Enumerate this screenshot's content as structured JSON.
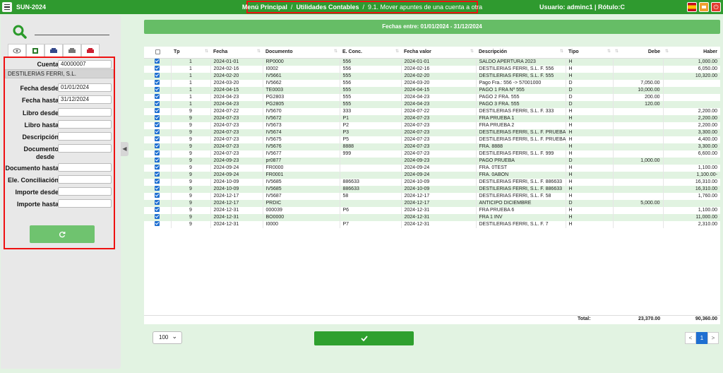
{
  "app": {
    "title": "SUN-2024"
  },
  "breadcrumb": {
    "item1": "Menú Principal",
    "item2": "Utilidades Contables",
    "current": "9.1. Mover apuntes de una cuenta a otra",
    "sep": "/"
  },
  "user": {
    "text": "Usuario: adminc1 | Rótulo:C"
  },
  "icons": {
    "menu": "hamburger-icon",
    "flag": "spain-flag-icon",
    "print": "print-icon",
    "power": "power-icon",
    "search": "search-icon",
    "refresh": "refresh-icon",
    "check": "check-icon"
  },
  "filters": {
    "cuenta_label": "Cuenta",
    "cuenta_value": "40000007",
    "company": "DESTILERIAS FERRI, S.L.",
    "fecha_desde_label": "Fecha desde",
    "fecha_desde_value": "01/01/2024",
    "fecha_hasta_label": "Fecha hasta",
    "fecha_hasta_value": "31/12/2024",
    "libro_desde_label": "Libro desde",
    "libro_hasta_label": "Libro hasta",
    "descripcion_label": "Descripción",
    "doc_desde_label1": "Documento",
    "doc_desde_label2": "desde",
    "doc_hasta_label": "Documento hasta",
    "ele_conc_label": "Ele. Conciliación",
    "importe_desde_label": "Importe desde",
    "importe_hasta_label": "Importe hasta"
  },
  "dates_bar": "Fechas entre: 01/01/2024 - 31/12/2024",
  "table": {
    "columns": [
      "Tp",
      "Fecha",
      "Documento",
      "E. Conc.",
      "Fecha valor",
      "Descripción",
      "Tipo",
      "Debe",
      "Haber"
    ],
    "rows": [
      [
        "1",
        "2024-01-01",
        "RP0000",
        "556",
        "2024-01-01",
        "SALDO APERTURA 2023",
        "H",
        "",
        "1,000.00"
      ],
      [
        "1",
        "2024-02-16",
        "I0002",
        "556",
        "2024-02-16",
        "DESTILERIAS FERRI, S.L. F. 556",
        "H",
        "",
        "6,050.00"
      ],
      [
        "1",
        "2024-02-20",
        "IV5661",
        "555",
        "2024-02-20",
        "DESTILERIAS FERRI, S.L. F. 555",
        "H",
        "",
        "10,320.00"
      ],
      [
        "1",
        "2024-03-20",
        "IV5662",
        "556",
        "2024-03-20",
        "Pago Fra.: 556 -> 57001000",
        "D",
        "7,050.00",
        ""
      ],
      [
        "1",
        "2024-04-15",
        "TE0003",
        "555",
        "2024-04-15",
        "PAGO 1 FRA Nº 555",
        "D",
        "10,000.00",
        ""
      ],
      [
        "1",
        "2024-04-23",
        "PG2803",
        "555",
        "2024-04-23",
        "PAGO 2 FRA. 555",
        "D",
        "200.00",
        ""
      ],
      [
        "1",
        "2024-04-23",
        "PG2805",
        "555",
        "2024-04-23",
        "PAGO 3 FRA. 555",
        "D",
        "120.00",
        ""
      ],
      [
        "9",
        "2024-07-22",
        "IV5670",
        "333",
        "2024-07-22",
        "DESTILERIAS FERRI, S.L. F. 333",
        "H",
        "",
        "2,200.00"
      ],
      [
        "9",
        "2024-07-23",
        "IV5672",
        "P1",
        "2024-07-23",
        "FRA PRUEBA 1",
        "H",
        "",
        "2,200.00"
      ],
      [
        "9",
        "2024-07-23",
        "IV5673",
        "P2",
        "2024-07-23",
        "FRA PRUEBA 2",
        "H",
        "",
        "2,200.00"
      ],
      [
        "9",
        "2024-07-23",
        "IV5674",
        "P3",
        "2024-07-23",
        "DESTILERIAS FERRI, S.L. F. PRUEBA 3",
        "H",
        "",
        "3,300.00"
      ],
      [
        "9",
        "2024-07-23",
        "IV5675",
        "P5",
        "2024-07-23",
        "DESTILERIAS FERRI, S.L. F. PRUEBA 5",
        "H",
        "",
        "4,400.00"
      ],
      [
        "9",
        "2024-07-23",
        "IV5676",
        "8888",
        "2024-07-23",
        "FRA. 8888",
        "H",
        "",
        "3,300.00"
      ],
      [
        "9",
        "2024-07-23",
        "IV5677",
        "999",
        "2024-07-23",
        "DESTILERIAS FERRI, S.L. F. 999",
        "H",
        "",
        "6,600.00"
      ],
      [
        "9",
        "2024-09-23",
        "pr0877",
        "",
        "2024-09-23",
        "PAGO PRUEBA",
        "D",
        "1,000.00",
        ""
      ],
      [
        "9",
        "2024-09-24",
        "FR0000",
        "",
        "2024-09-24",
        "FRA. 0TEST",
        "H",
        "",
        "1,100.00"
      ],
      [
        "9",
        "2024-09-24",
        "FR0001",
        "",
        "2024-09-24",
        "FRA. 0ABON",
        "H",
        "",
        "1,100.00-"
      ],
      [
        "9",
        "2024-10-09",
        "IV5685",
        "886633",
        "2024-10-09",
        "DESTILERIAS FERRI, S.L. F. 886633",
        "H",
        "",
        "16,310.00"
      ],
      [
        "9",
        "2024-10-09",
        "IV5685",
        "886633",
        "2024-10-09",
        "DESTILERIAS FERRI, S.L. F. 886633",
        "H",
        "",
        "16,310.00"
      ],
      [
        "9",
        "2024-12-17",
        "IV5687",
        "58",
        "2024-12-17",
        "DESTILERIAS FERRI, S.L. F. 58",
        "H",
        "",
        "1,760.00"
      ],
      [
        "9",
        "2024-12-17",
        "PRDIC",
        "",
        "2024-12-17",
        "ANTICIPO DICIEMBRE",
        "D",
        "5,000.00",
        ""
      ],
      [
        "9",
        "2024-12-31",
        "000039",
        "P6",
        "2024-12-31",
        "FRA PRUEBA 6",
        "H",
        "",
        "1,100.00"
      ],
      [
        "9",
        "2024-12-31",
        "BO0000",
        "",
        "2024-12-31",
        "FRA 1 INV",
        "H",
        "",
        "11,000.00"
      ],
      [
        "9",
        "2024-12-31",
        "I0000",
        "P7",
        "2024-12-31",
        "DESTILERIAS FERRI, S.L. F. 7",
        "H",
        "",
        "2,310.00"
      ]
    ]
  },
  "totals": {
    "label": "Total:",
    "debe": "23,370.00",
    "haber": "90,360.00"
  },
  "pagination": {
    "page_size": "100",
    "prev": "<",
    "current": "1",
    "next": ">"
  }
}
